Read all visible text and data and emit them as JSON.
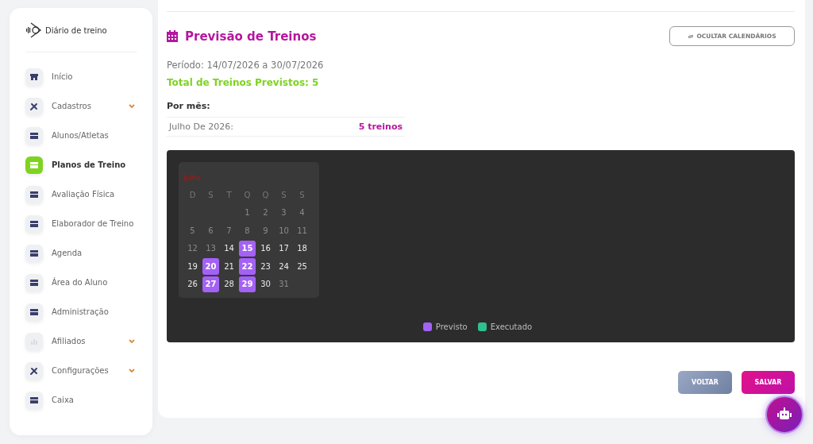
{
  "brand": {
    "name": "Diário de treino"
  },
  "sidebar": {
    "items": [
      {
        "label": "Início",
        "kind": "store",
        "selected": false,
        "expandable": false
      },
      {
        "label": "Cadastros",
        "kind": "tools",
        "selected": false,
        "expandable": true
      },
      {
        "label": "Alunos/Atletas",
        "kind": "card",
        "selected": false,
        "expandable": false
      },
      {
        "label": "Planos de Treino",
        "kind": "card",
        "selected": true,
        "expandable": false
      },
      {
        "label": "Avaliação Física",
        "kind": "card",
        "selected": false,
        "expandable": false
      },
      {
        "label": "Elaborador de Treino",
        "kind": "card",
        "selected": false,
        "expandable": false
      },
      {
        "label": "Agenda",
        "kind": "card",
        "selected": false,
        "expandable": false
      },
      {
        "label": "Área do Aluno",
        "kind": "card",
        "selected": false,
        "expandable": false
      },
      {
        "label": "Administração",
        "kind": "card",
        "selected": false,
        "expandable": false
      },
      {
        "label": "Afiliados",
        "kind": "chart",
        "selected": false,
        "expandable": true
      },
      {
        "label": "Configurações",
        "kind": "tools",
        "selected": false,
        "expandable": true
      },
      {
        "label": "Caixa",
        "kind": "card",
        "selected": false,
        "expandable": false
      }
    ]
  },
  "header": {
    "title": "Previsão de Treinos",
    "toggle_button": "OCULTAR CALENDÁRIOS"
  },
  "summary": {
    "period": "Período: 14/07/2026 a 30/07/2026",
    "total": "Total de Treinos Previstos: 5",
    "by_month_label": "Por mês:",
    "months": [
      {
        "month": "Julho De 2026:",
        "count": "5 treinos"
      }
    ]
  },
  "calendar": {
    "month": "julho",
    "weekdays": [
      "D",
      "S",
      "T",
      "Q",
      "Q",
      "S",
      "S"
    ],
    "days": [
      {
        "day": "1",
        "in_period": false,
        "planned": false
      },
      {
        "day": "2",
        "in_period": false,
        "planned": false
      },
      {
        "day": "3",
        "in_period": false,
        "planned": false
      },
      {
        "day": "4",
        "in_period": false,
        "planned": false
      },
      {
        "day": "5",
        "in_period": false,
        "planned": false
      },
      {
        "day": "6",
        "in_period": false,
        "planned": false
      },
      {
        "day": "7",
        "in_period": false,
        "planned": false
      },
      {
        "day": "8",
        "in_period": false,
        "planned": false
      },
      {
        "day": "9",
        "in_period": false,
        "planned": false
      },
      {
        "day": "10",
        "in_period": false,
        "planned": false
      },
      {
        "day": "11",
        "in_period": false,
        "planned": false
      },
      {
        "day": "12",
        "in_period": false,
        "planned": false
      },
      {
        "day": "13",
        "in_period": false,
        "planned": false
      },
      {
        "day": "14",
        "in_period": true,
        "planned": false
      },
      {
        "day": "15",
        "in_period": true,
        "planned": true
      },
      {
        "day": "16",
        "in_period": true,
        "planned": false
      },
      {
        "day": "17",
        "in_period": true,
        "planned": false
      },
      {
        "day": "18",
        "in_period": true,
        "planned": false
      },
      {
        "day": "19",
        "in_period": true,
        "planned": false
      },
      {
        "day": "20",
        "in_period": true,
        "planned": true
      },
      {
        "day": "21",
        "in_period": true,
        "planned": false
      },
      {
        "day": "22",
        "in_period": true,
        "planned": true
      },
      {
        "day": "23",
        "in_period": true,
        "planned": false
      },
      {
        "day": "24",
        "in_period": true,
        "planned": false
      },
      {
        "day": "25",
        "in_period": true,
        "planned": false
      },
      {
        "day": "26",
        "in_period": true,
        "planned": false
      },
      {
        "day": "27",
        "in_period": true,
        "planned": true
      },
      {
        "day": "28",
        "in_period": true,
        "planned": false
      },
      {
        "day": "29",
        "in_period": true,
        "planned": true
      },
      {
        "day": "30",
        "in_period": true,
        "planned": false
      },
      {
        "day": "31",
        "in_period": false,
        "planned": false
      }
    ],
    "legend": [
      {
        "label": "Previsto",
        "color": "#a461f5"
      },
      {
        "label": "Executado",
        "color": "#2ec08e"
      }
    ]
  },
  "actions": {
    "back": "VOLTAR",
    "save": "SALVAR"
  }
}
